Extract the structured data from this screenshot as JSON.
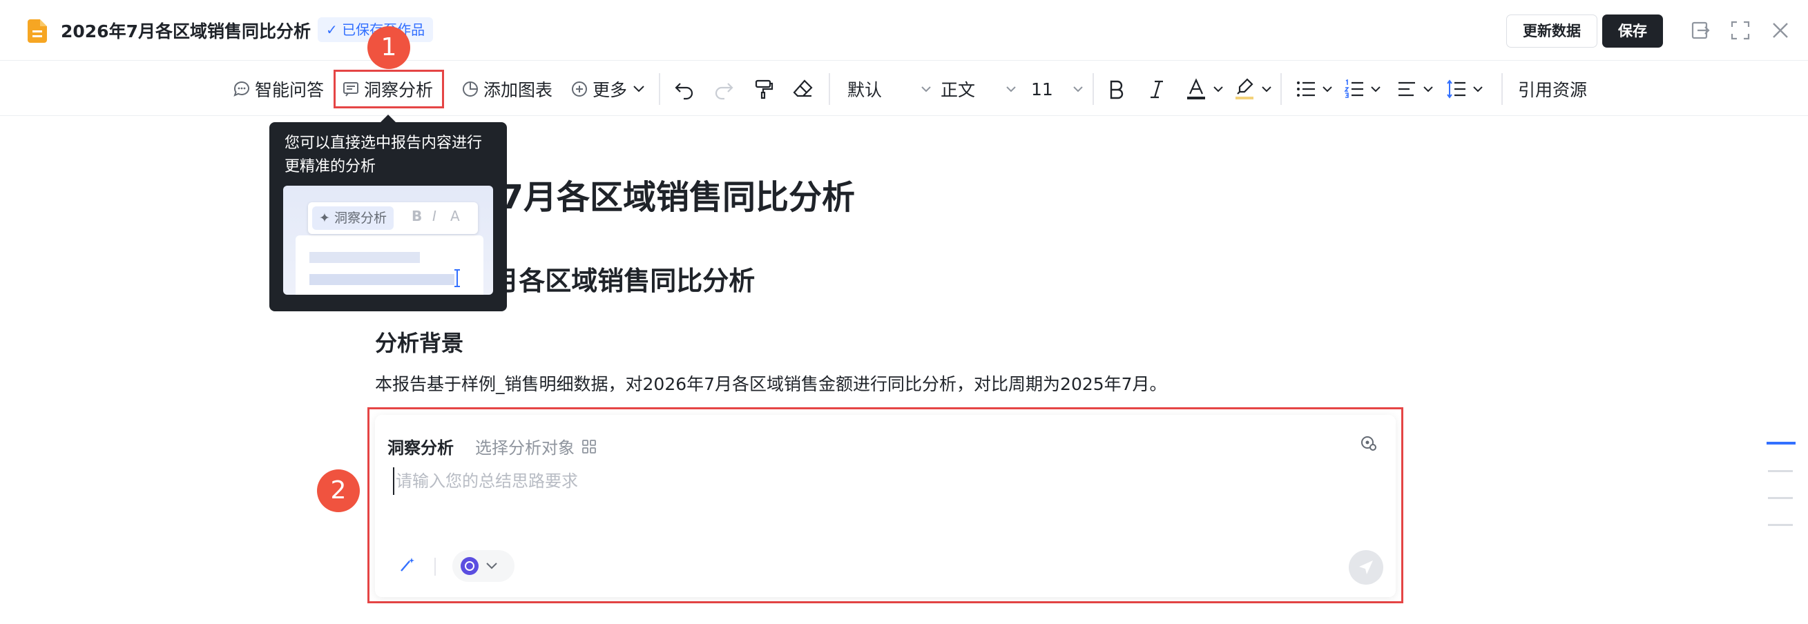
{
  "header": {
    "doc_title": "2026年7月各区域销售同比分析",
    "saved_badge": "✓ 已保存至作品",
    "update_button": "更新数据",
    "save_button": "保存"
  },
  "toolbar": {
    "smart_qa": "智能问答",
    "insight": "洞察分析",
    "add_chart": "添加图表",
    "more": "更多",
    "style_select": "默认",
    "paragraph_select": "正文",
    "font_size": "11",
    "cite": "引用资源"
  },
  "tooltip": {
    "text": "您可以直接选中报告内容进行更精准的分析",
    "preview_chip": "洞察分析"
  },
  "markers": {
    "one": "1",
    "two": "2"
  },
  "document": {
    "h1": "2026年7月各区域销售同比分析",
    "h2": "2026年7月各区域销售同比分析",
    "h3": "分析背景",
    "paragraph": "本报告基于样例_销售明细数据，对2026年7月各区域销售金额进行同比分析，对比周期为2025年7月。"
  },
  "panel": {
    "title": "洞察分析",
    "target_label": "选择分析对象",
    "input_placeholder": "请输入您的总结思路要求",
    "input_value": ""
  },
  "colors": {
    "accent": "#3370ff",
    "highlight": "#e54545",
    "marker": "#f0533f",
    "dark": "#1f2329"
  }
}
